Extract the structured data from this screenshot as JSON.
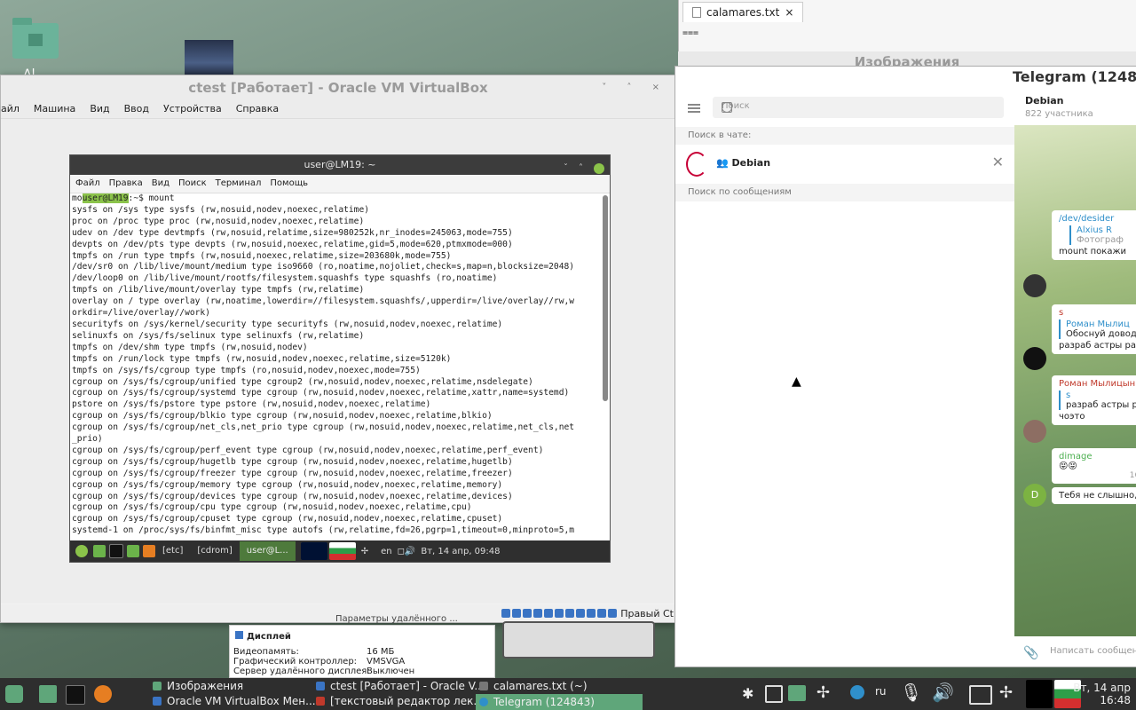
{
  "desktop": {
    "label": "Al"
  },
  "vbox": {
    "title": "ctest [Работает] - Oracle VM VirtualBox",
    "menu": [
      "айл",
      "Машина",
      "Вид",
      "Ввод",
      "Устройства",
      "Справка"
    ],
    "status_right": "Правый Ct"
  },
  "terminal": {
    "title": "user@LM19: ~",
    "menu": [
      "Файл",
      "Правка",
      "Вид",
      "Поиск",
      "Терминал",
      "Помощь"
    ],
    "prompt_pre": "mo",
    "prompt_user": "user@LM19",
    "prompt_rest": ":~$ mount",
    "lines": [
      "sysfs on /sys type sysfs (rw,nosuid,nodev,noexec,relatime)",
      "proc on /proc type proc (rw,nosuid,nodev,noexec,relatime)",
      "udev on /dev type devtmpfs (rw,nosuid,relatime,size=980252k,nr_inodes=245063,mode=755)",
      "devpts on /dev/pts type devpts (rw,nosuid,noexec,relatime,gid=5,mode=620,ptmxmode=000)",
      "tmpfs on /run type tmpfs (rw,nosuid,noexec,relatime,size=203680k,mode=755)",
      "/dev/sr0 on /lib/live/mount/medium type iso9660 (ro,noatime,nojoliet,check=s,map=n,blocksize=2048)",
      "/dev/loop0 on /lib/live/mount/rootfs/filesystem.squashfs type squashfs (ro,noatime)",
      "tmpfs on /lib/live/mount/overlay type tmpfs (rw,relatime)",
      "overlay on / type overlay (rw,noatime,lowerdir=//filesystem.squashfs/,upperdir=/live/overlay//rw,w",
      "orkdir=/live/overlay//work)",
      "securityfs on /sys/kernel/security type securityfs (rw,nosuid,nodev,noexec,relatime)",
      "selinuxfs on /sys/fs/selinux type selinuxfs (rw,relatime)",
      "tmpfs on /dev/shm type tmpfs (rw,nosuid,nodev)",
      "tmpfs on /run/lock type tmpfs (rw,nosuid,nodev,noexec,relatime,size=5120k)",
      "tmpfs on /sys/fs/cgroup type tmpfs (ro,nosuid,nodev,noexec,mode=755)",
      "cgroup on /sys/fs/cgroup/unified type cgroup2 (rw,nosuid,nodev,noexec,relatime,nsdelegate)",
      "cgroup on /sys/fs/cgroup/systemd type cgroup (rw,nosuid,nodev,noexec,relatime,xattr,name=systemd)",
      "pstore on /sys/fs/pstore type pstore (rw,nosuid,nodev,noexec,relatime)",
      "cgroup on /sys/fs/cgroup/blkio type cgroup (rw,nosuid,nodev,noexec,relatime,blkio)",
      "cgroup on /sys/fs/cgroup/net_cls,net_prio type cgroup (rw,nosuid,nodev,noexec,relatime,net_cls,net",
      "_prio)",
      "cgroup on /sys/fs/cgroup/perf_event type cgroup (rw,nosuid,nodev,noexec,relatime,perf_event)",
      "cgroup on /sys/fs/cgroup/hugetlb type cgroup (rw,nosuid,nodev,noexec,relatime,hugetlb)",
      "cgroup on /sys/fs/cgroup/freezer type cgroup (rw,nosuid,nodev,noexec,relatime,freezer)",
      "cgroup on /sys/fs/cgroup/memory type cgroup (rw,nosuid,nodev,noexec,relatime,memory)",
      "cgroup on /sys/fs/cgroup/devices type cgroup (rw,nosuid,nodev,noexec,relatime,devices)",
      "cgroup on /sys/fs/cgroup/cpu type cgroup (rw,nosuid,nodev,noexec,relatime,cpu)",
      "cgroup on /sys/fs/cgroup/cpuset type cgroup (rw,nosuid,nodev,noexec,relatime,cpuset)",
      "systemd-1 on /proc/sys/fs/binfmt_misc type autofs (rw,relatime,fd=26,pgrp=1,timeout=0,minproto=5,m"
    ]
  },
  "guest_panel": {
    "windows": [
      "[etc]",
      "[cdrom]",
      "user@L..."
    ],
    "lang": "en",
    "clock": "Вт, 14 апр, 09:48"
  },
  "calamares": {
    "tab_label": "calamares.txt",
    "content": "==="
  },
  "images_window": {
    "title": "Изображения"
  },
  "telegram": {
    "title": "Telegram (12484",
    "search_placeholder": "Поиск",
    "search_in_chat": "Поиск в чате:",
    "chat_name": "Debian",
    "search_messages": "Поиск по сообщениям",
    "header_name": "Debian",
    "header_members": "822 участника",
    "messages": [
      {
        "name": "/dev/desider",
        "quote_author": "Alxius R",
        "quote_text": "Фотограф",
        "text": "mount покажи"
      },
      {
        "name": "s",
        "quote_author": "Роман Мылиц",
        "quote_text": "Обоснуй довод",
        "text": "разраб астры раз"
      },
      {
        "name": "Роман Мылицын",
        "quote_author": "s",
        "quote_text": "разраб астры ра",
        "text": "чоэто"
      },
      {
        "name": "dimage",
        "text": "😝😝",
        "time": "16:1"
      },
      {
        "name": "",
        "text": "Тебя не слышно, "
      }
    ],
    "avatar_letter": "D",
    "input_placeholder": "Написать сообщени"
  },
  "info_pane": {
    "header": "Дисплей",
    "rows": [
      {
        "k": "Видеопамять:",
        "v": "16 МБ"
      },
      {
        "k": "Графический контроллер:",
        "v": "VMSVGA"
      },
      {
        "k": "Сервер удалённого дисплея:",
        "v": "Выключен"
      }
    ],
    "caption": "Параметры удалённого ..."
  },
  "taskbar": {
    "items_top": [
      "Изображения",
      "ctest [Работает] - Oracle V...",
      "calamares.txt (~)"
    ],
    "items_bottom": [
      "Oracle VM VirtualBox Мен...",
      "[текстовый редактор лек...",
      "Telegram (124843)"
    ],
    "lang": "ru",
    "clock_line1": "Вт, 14 апр",
    "clock_line2": "16:48"
  }
}
